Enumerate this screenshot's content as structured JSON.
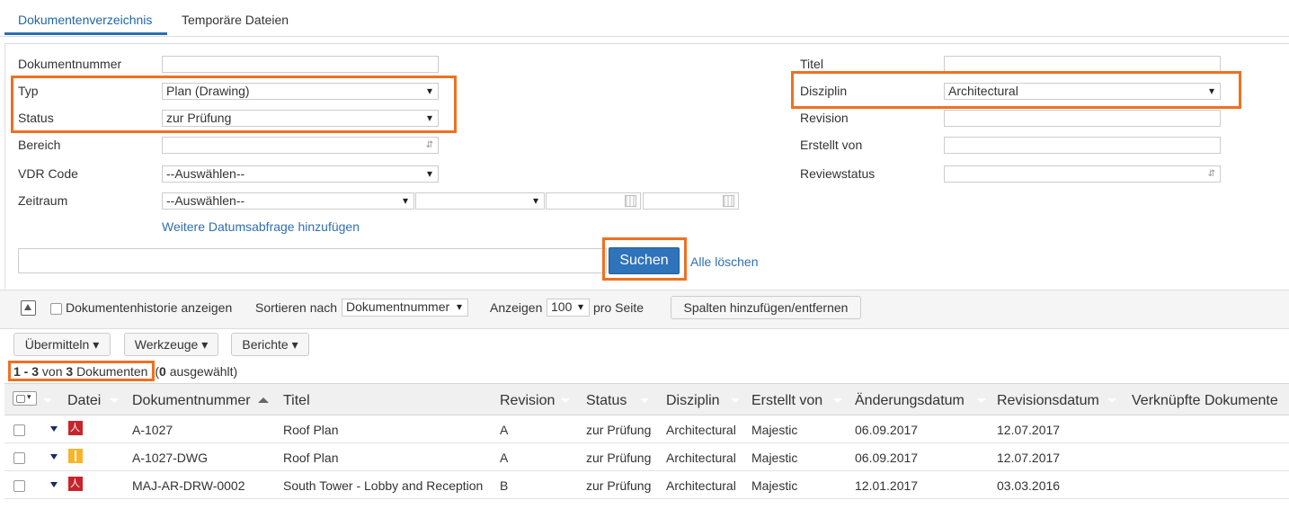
{
  "tabs": [
    {
      "label": "Dokumentenverzeichnis"
    },
    {
      "label": "Temporäre Dateien"
    }
  ],
  "form": {
    "left": {
      "dokumentnummer": {
        "label": "Dokumentnummer",
        "value": ""
      },
      "typ": {
        "label": "Typ",
        "value": "Plan (Drawing)"
      },
      "status": {
        "label": "Status",
        "value": "zur Prüfung"
      },
      "bereich": {
        "label": "Bereich",
        "value": ""
      },
      "vdr_code": {
        "label": "VDR Code",
        "value": "--Auswählen--"
      },
      "zeitraum": {
        "label": "Zeitraum",
        "value": "--Auswählen--",
        "value2": "",
        "date_from": "",
        "date_to": ""
      },
      "add_date_link": "Weitere Datumsabfrage hinzufügen"
    },
    "right": {
      "titel": {
        "label": "Titel",
        "value": ""
      },
      "disziplin": {
        "label": "Disziplin",
        "value": "Architectural"
      },
      "revision": {
        "label": "Revision",
        "value": ""
      },
      "erstellt_von": {
        "label": "Erstellt von",
        "value": ""
      },
      "reviewstatus": {
        "label": "Reviewstatus",
        "value": ""
      }
    },
    "search_value": "",
    "search_button": "Suchen",
    "clear_link": "Alle löschen"
  },
  "toolbar": {
    "history_label": "Dokumentenhistorie anzeigen",
    "sort_label": "Sortieren nach",
    "sort_value": "Dokumentnummer",
    "show_label": "Anzeigen",
    "show_value": "100",
    "per_page_label": "pro Seite",
    "columns_button": "Spalten hinzufügen/entfernen"
  },
  "actions": {
    "transmit": "Übermitteln",
    "tools": "Werkzeuge",
    "reports": "Berichte"
  },
  "count": {
    "range": "1 - 3",
    "von": "von",
    "total": "3",
    "docs": "Dokumenten",
    "selected_open": "(",
    "selected": "0",
    "selected_close": "ausgewählt)"
  },
  "columns": [
    "Datei",
    "Dokumentnummer",
    "Titel",
    "Revision",
    "Status",
    "Disziplin",
    "Erstellt von",
    "Änderungsdatum",
    "Revisionsdatum",
    "Verknüpfte Dokumente"
  ],
  "rows": [
    {
      "file_icon": "pdf-icon",
      "number": "A-1027",
      "title": "Roof Plan",
      "revision": "A",
      "status": "zur Prüfung",
      "discipline": "Architectural",
      "created_by": "Majestic",
      "modified": "06.09.2017",
      "revision_date": "12.07.2017",
      "linked": ""
    },
    {
      "file_icon": "dwg-icon",
      "number": "A-1027-DWG",
      "title": "Roof Plan",
      "revision": "A",
      "status": "zur Prüfung",
      "discipline": "Architectural",
      "created_by": "Majestic",
      "modified": "06.09.2017",
      "revision_date": "12.07.2017",
      "linked": ""
    },
    {
      "file_icon": "pdf-icon",
      "number": "MAJ-AR-DRW-0002",
      "title": "South Tower - Lobby and Reception",
      "revision": "B",
      "status": "zur Prüfung",
      "discipline": "Architectural",
      "created_by": "Majestic",
      "modified": "12.01.2017",
      "revision_date": "03.03.2016",
      "linked": ""
    }
  ],
  "colors": {
    "accent": "#2f73ba",
    "highlight": "#f07020",
    "link": "#2f6fb0"
  }
}
